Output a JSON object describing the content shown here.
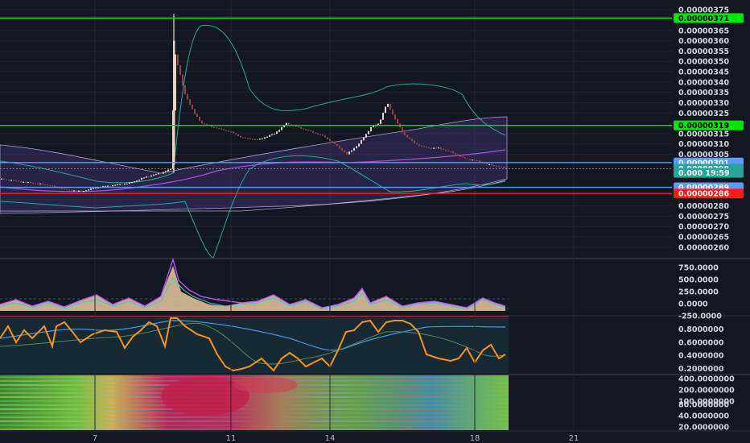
{
  "chart_data": {
    "type": "candlestick",
    "x_tick_labels": [
      "7",
      "11",
      "14",
      "18",
      "21"
    ],
    "main_pane": {
      "y_tick_labels": [
        "0.00000375",
        "0.00000365",
        "0.00000360",
        "0.00000355",
        "0.00000350",
        "0.00000345",
        "0.00000340",
        "0.00000335",
        "0.00000330",
        "0.00000325",
        "0.00000315",
        "0.00000310",
        "0.00000305",
        "0.00000280",
        "0.00000275",
        "0.00000270",
        "0.00000265",
        "0.00000260"
      ],
      "ylim": [
        2.58e-06,
        3.77e-06
      ],
      "price_tags": [
        {
          "label": "0.00000371",
          "value": 3.71e-06,
          "color": "#00e600"
        },
        {
          "label": "0.00000319",
          "value": 3.19e-06,
          "color": "#00e600"
        },
        {
          "label": "0.00000301",
          "value": 3.01e-06,
          "color": "#5b9cf6"
        },
        {
          "label": "0.00000298",
          "value": 2.98e-06,
          "color": "#26a69a"
        },
        {
          "label": "0.000 19:59",
          "value": 2.96e-06,
          "color": "#26a69a"
        },
        {
          "label": "0.00000289",
          "value": 2.89e-06,
          "color": "#5b9cf6"
        },
        {
          "label": "0.00000286",
          "value": 2.86e-06,
          "color": "#ff1a1a"
        }
      ],
      "horizontal_lines": [
        {
          "value": 3.71e-06,
          "color": "#00e600"
        },
        {
          "value": 3.19e-06,
          "color": "#00e600"
        },
        {
          "value": 3.01e-06,
          "color": "#5b9cf6"
        },
        {
          "value": 2.89e-06,
          "color": "#5b9cf6"
        },
        {
          "value": 2.86e-06,
          "color": "#ff1a1a"
        }
      ]
    },
    "oscillator_pane_1": {
      "y_tick_labels": [
        "750.0000",
        "500.0000",
        "250.0000",
        "0.0000",
        "-250.0000"
      ],
      "ylim": [
        -250,
        900
      ]
    },
    "oscillator_pane_2": {
      "y_tick_labels": [
        "0.8000000",
        "0.6000000",
        "0.4000000",
        "0.2000000"
      ],
      "ylim": [
        0.12,
        0.98
      ]
    },
    "heatmap_pane": {
      "y_tick_labels": [
        "400.0000000",
        "200.0000000",
        "100.0000000",
        "80.0000000",
        "40.0000000",
        "20.0000000"
      ]
    },
    "colors": {
      "background": "#131722",
      "grid": "#2a2e39",
      "candle_up": "#e8d5c0",
      "candle_down": "#8a3b3b",
      "bollinger": "#26a69a",
      "envelope_fill": "#3b2f63",
      "ma_purple": "#9c27b0",
      "oscillator_orange": "#f7931a"
    }
  }
}
